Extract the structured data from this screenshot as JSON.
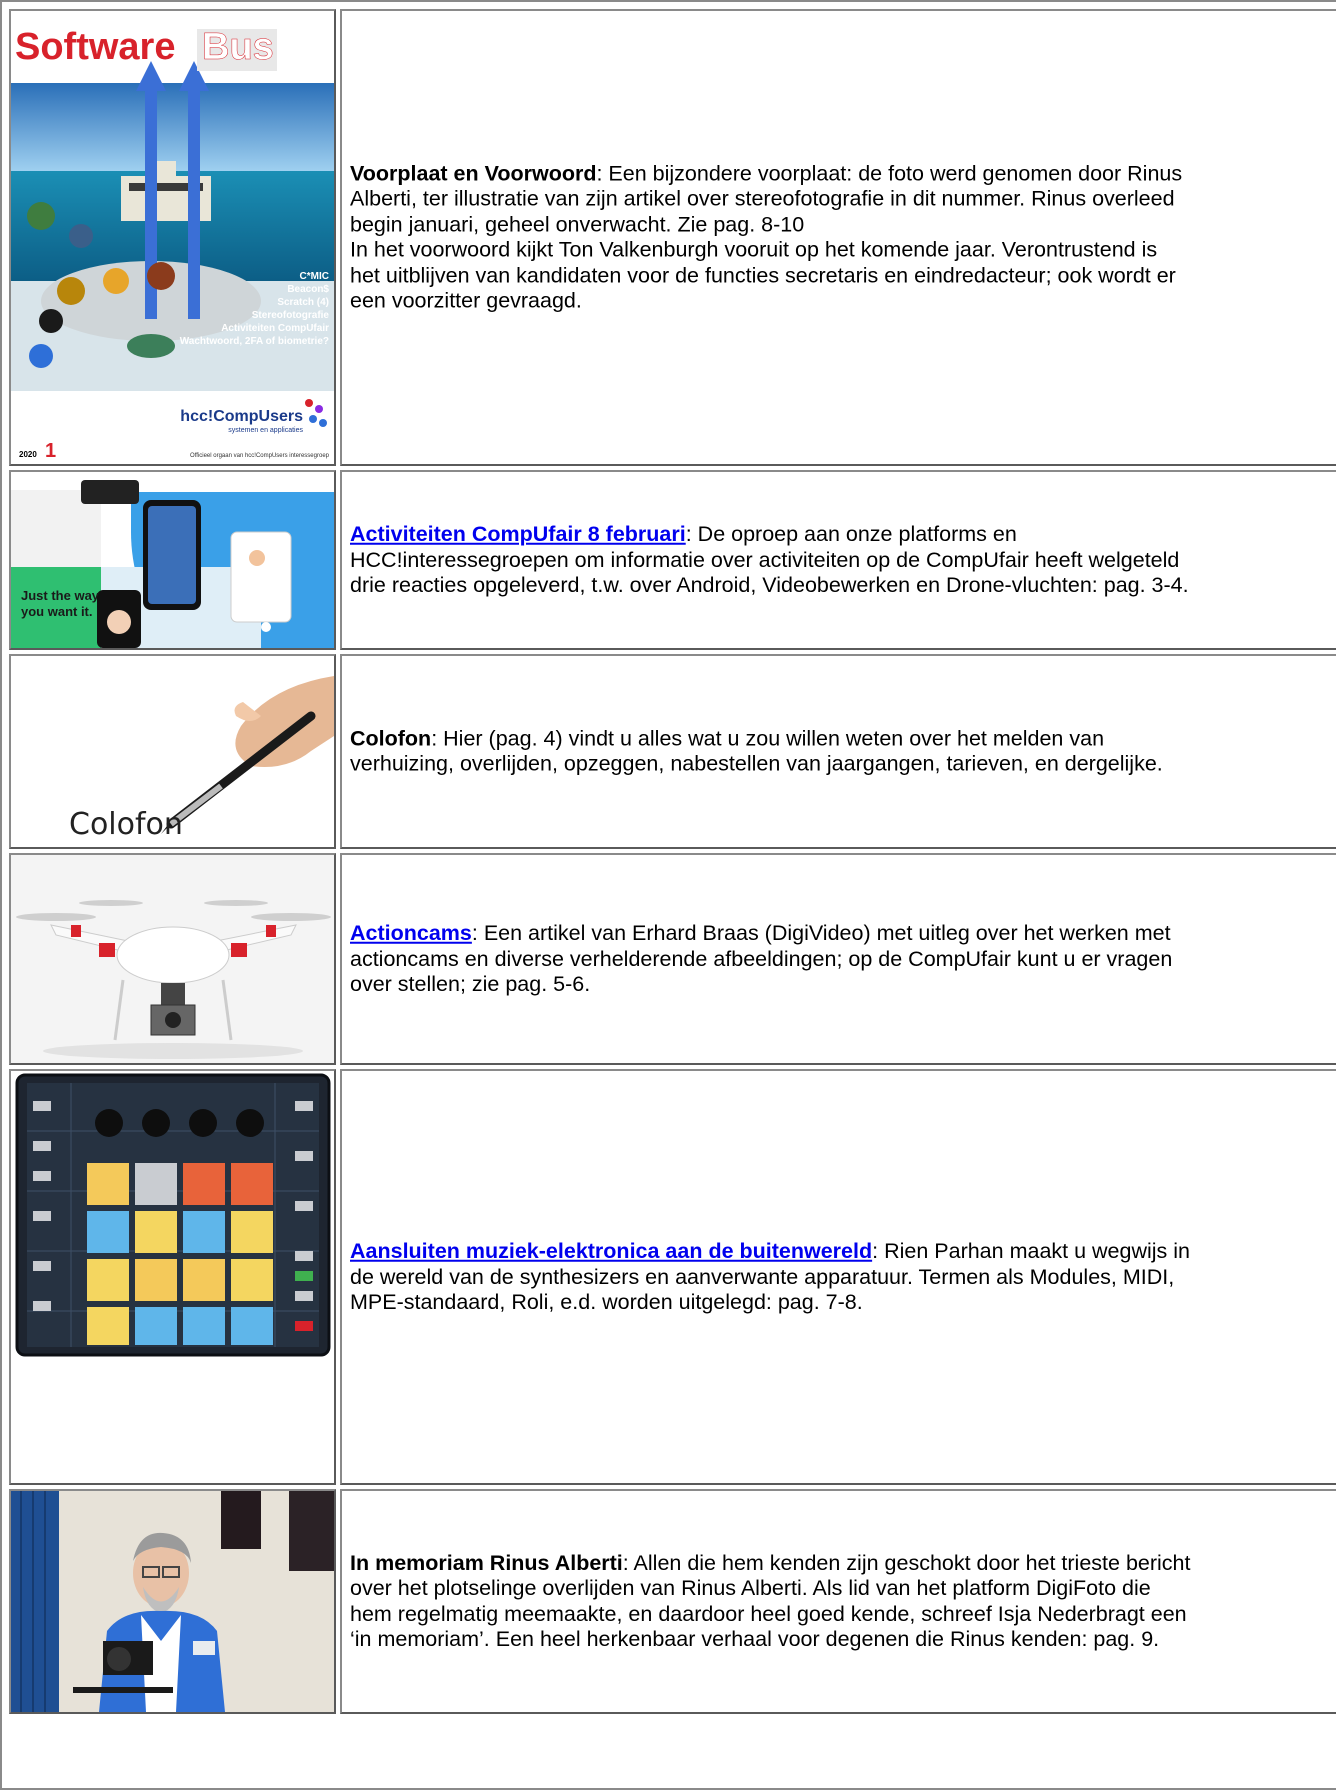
{
  "rows": [
    {
      "image": {
        "cover_title_1": "Software",
        "cover_title_2": "Bus",
        "cover_year": "2020",
        "cover_issue": "1",
        "cover_logo": "hcc!CompUsers",
        "cover_logo_sub": "systemen en applicaties",
        "cover_footer": "Officieel orgaan van hcc!CompUsers interessegroep",
        "cover_topics": [
          "C*MIC",
          "Beacon$",
          "Scratch (4)",
          "Stereofotografie",
          "Activiteiten CompUfair",
          "Wachtwoord, 2FA of biometrie?"
        ]
      },
      "title": "Voorplaat en Voorwoord",
      "lines": [
        "Een bijzondere voorplaat: de foto werd genomen door Rinus",
        "Alberti, ter illustratie van zijn artikel over stereofotografie in dit nummer. Rinus overleed",
        "begin januari, geheel onverwacht. Zie pag. 8-10",
        "In het voorwoord kijkt Ton Valkenburgh vooruit op het komende jaar. Verontrustend is",
        "het uitblijven van kandidaten voor de functies secretaris en eindredacteur; ook wordt er",
        "een voorzitter gevraagd."
      ]
    },
    {
      "image": {
        "tagline_1": "Just the way",
        "tagline_2": "you want it."
      },
      "title": "Activiteiten CompUfair 8 februari",
      "lines": [
        "De oproep aan onze platforms en",
        "HCC!interessegroepen om informatie over activiteiten op de CompUfair heeft welgeteld",
        "drie reacties opgeleverd, t.w. over Android, Videobewerken en Drone-vluchten: pag. 3-4."
      ]
    },
    {
      "image": {
        "word": "Colofon"
      },
      "title": "Colofon",
      "lines": [
        "Hier (pag. 4) vindt u alles wat u zou willen weten over het melden van",
        "verhuizing, overlijden, opzeggen, nabestellen van jaargangen, tarieven, en dergelijke."
      ]
    },
    {
      "image": {},
      "title": "Actioncams",
      "lines": [
        "Een artikel van Erhard Braas (DigiVideo) met uitleg over het werken met",
        "actioncams en diverse verhelderende afbeeldingen; op de CompUfair kunt u er vragen",
        "over stellen; zie pag. 5-6."
      ]
    },
    {
      "image": {},
      "title": "Aansluiten muziek-elektronica aan de buitenwereld",
      "lines": [
        "Rien Parhan maakt u wegwijs in",
        "de wereld van de synthesizers en aanverwante apparatuur. Termen als Modules, MIDI,",
        "MPE-standaard, Roli, e.d. worden uitgelegd: pag. 7-8."
      ]
    },
    {
      "image": {},
      "title": "In memoriam Rinus Alberti",
      "lines": [
        "Allen die hem kenden zijn geschokt door het trieste bericht",
        "over het plotselinge overlijden van Rinus Alberti. Als lid van het platform DigiFoto die",
        "hem regelmatig meemaakte, en daardoor heel goed kende, schreef Isja Nederbragt een",
        "‘in memoriam’. Een heel herkenbaar verhaal voor degenen die Rinus kenden: pag. 9."
      ]
    }
  ]
}
